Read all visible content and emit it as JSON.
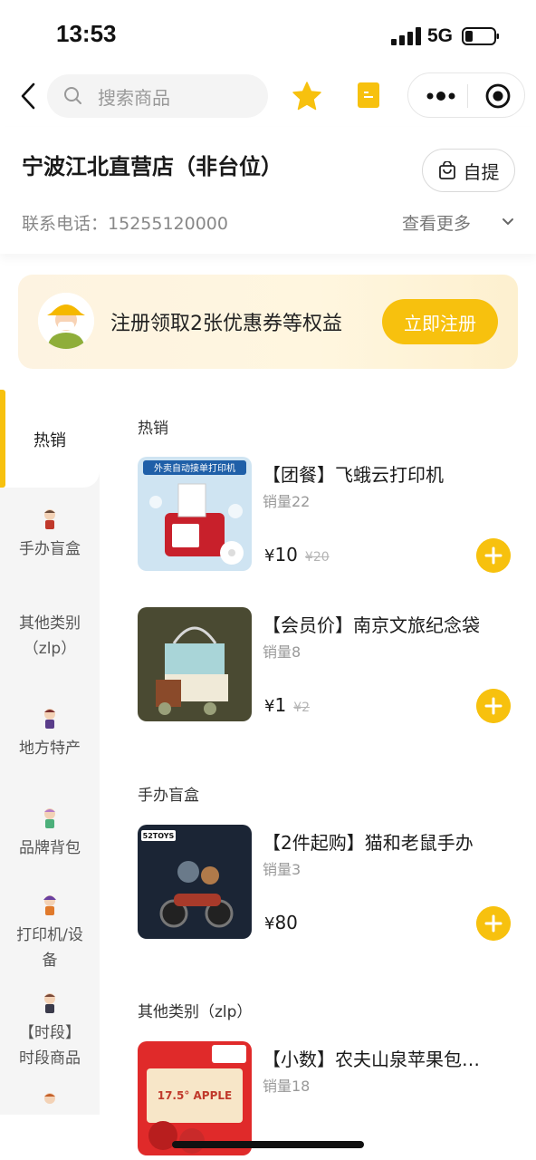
{
  "status_bar": {
    "time": "13:53",
    "network": "5G"
  },
  "nav": {
    "search_placeholder": "搜索商品"
  },
  "store": {
    "name": "宁波江北直营店（非台位）",
    "pickup_label": "自提",
    "phone_label": "联系电话：",
    "phone": "15255120000",
    "view_more": "查看更多"
  },
  "promo": {
    "text": "注册领取2张优惠券等权益",
    "button": "立即注册"
  },
  "sidebar": {
    "active": "热销",
    "items": [
      {
        "label": "手办盲盒"
      },
      {
        "label": "其他类别",
        "label2": "（zlp）"
      },
      {
        "label": "地方特产"
      },
      {
        "label": "品牌背包"
      },
      {
        "label": "打印机/设",
        "label2": "备"
      },
      {
        "label": "【时段】",
        "label2": "时段商品"
      }
    ]
  },
  "sections": [
    {
      "title": "热销",
      "products": [
        {
          "name": "【团餐】飞蛾云打印机",
          "sales": "销量22",
          "currency": "¥",
          "price": "10",
          "original_price": "¥20",
          "image_text": "外卖自动接单打印机"
        },
        {
          "name": "【会员价】南京文旅纪念袋",
          "sales": "销量8",
          "currency": "¥",
          "price": "1",
          "original_price": "¥2"
        }
      ]
    },
    {
      "title": "手办盲盒",
      "products": [
        {
          "name": "【2件起购】猫和老鼠手办",
          "sales": "销量3",
          "currency": "¥",
          "price": "80",
          "image_text": "52TOYS"
        }
      ]
    },
    {
      "title": "其他类别（zlp）",
      "products": [
        {
          "name": "【小数】农夫山泉苹果包…",
          "sales": "销量18",
          "image_text": "17.5° APPLE"
        }
      ]
    }
  ],
  "colors": {
    "accent": "#f7c10e",
    "promo_bg": "#fdf3e1"
  }
}
